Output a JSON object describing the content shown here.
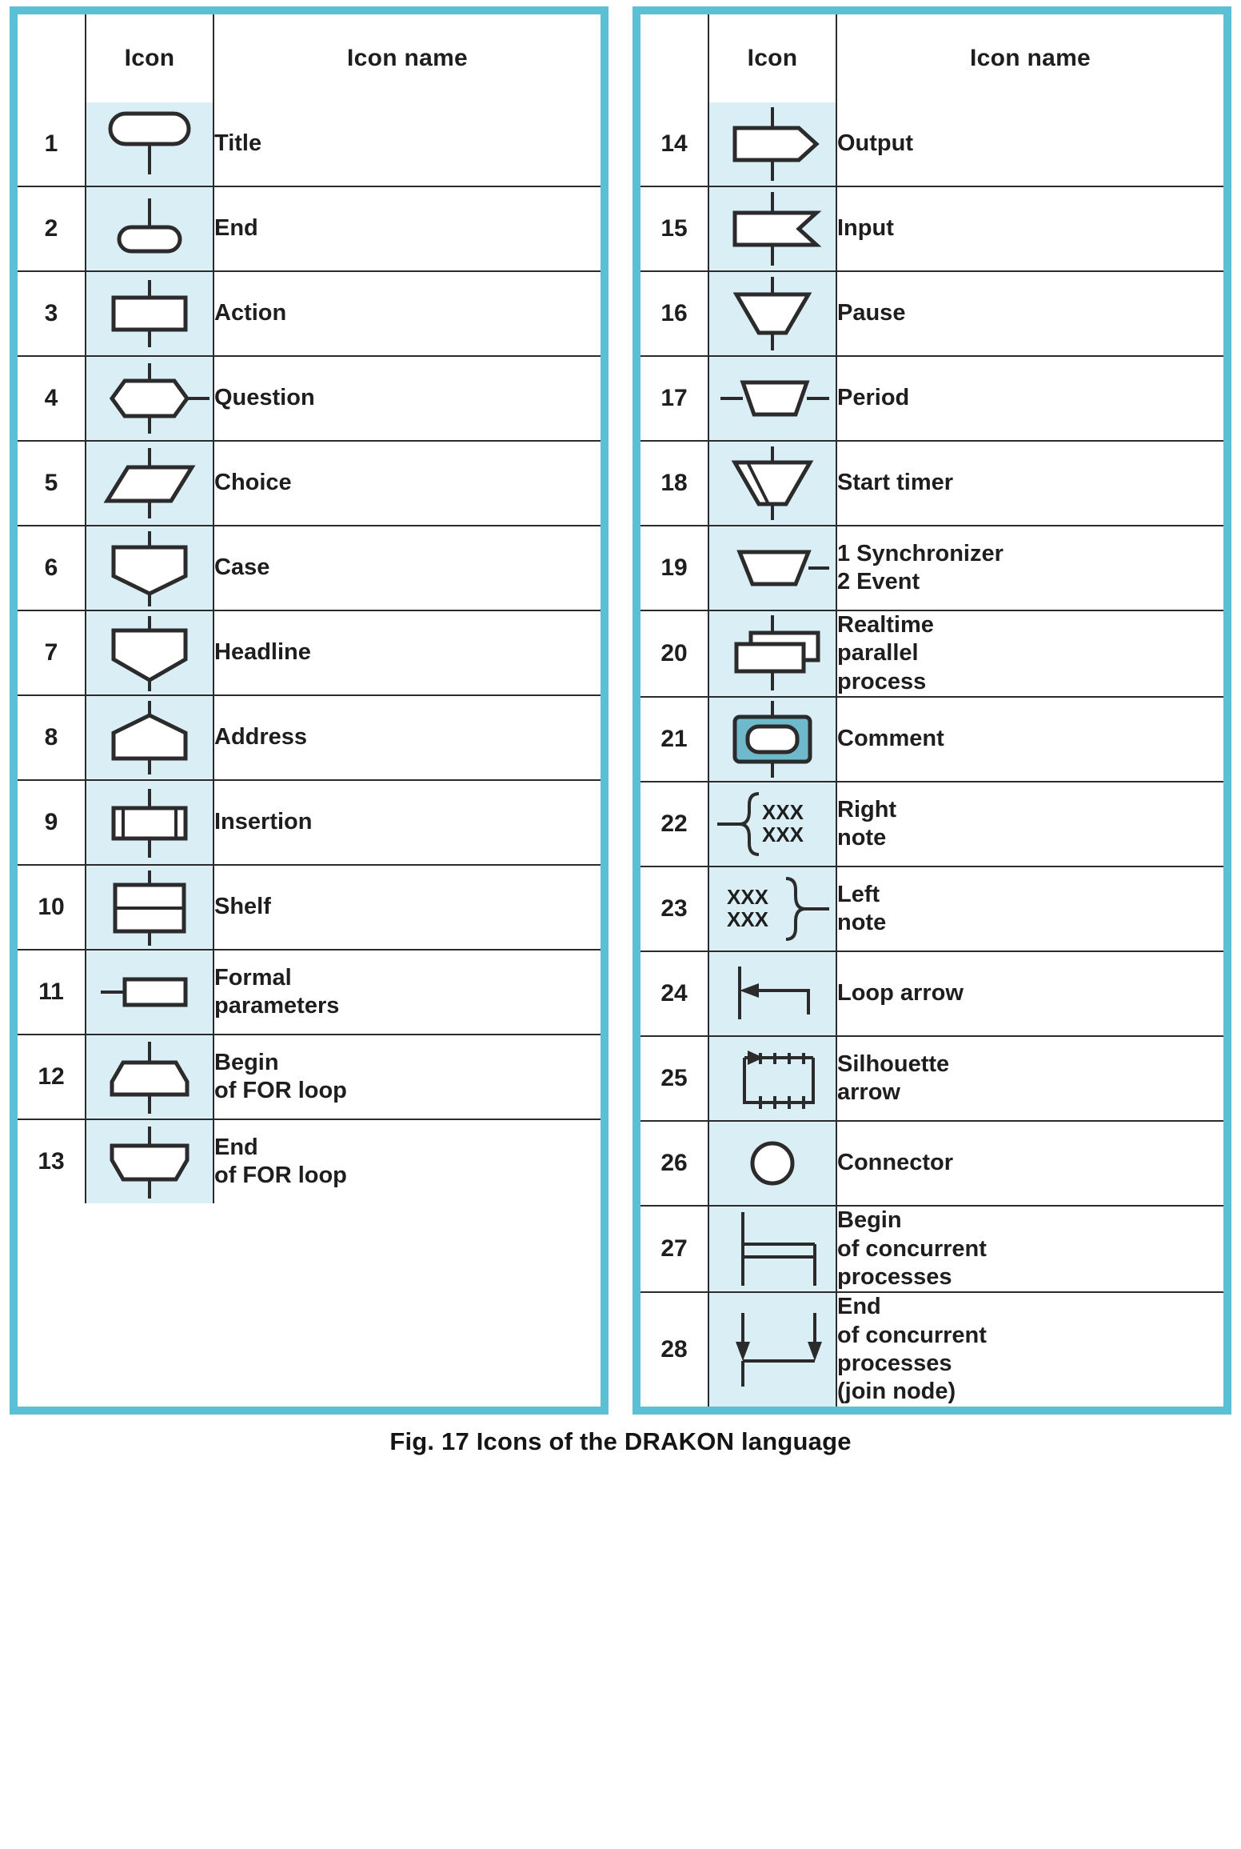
{
  "caption": "Fig. 17  Icons of the DRAKON language",
  "theme": {
    "frame_color": "#5bc0d4",
    "icon_cell_bg": "#d9eef5",
    "line_color": "#2b2b2b",
    "text_color": "#1e1e1e"
  },
  "left_table": {
    "headers": {
      "number": "",
      "icon": "Icon",
      "name": "Icon name"
    },
    "rows": [
      {
        "num": "1",
        "icon": "title-icon",
        "name_lines": [
          "Title"
        ]
      },
      {
        "num": "2",
        "icon": "end-icon",
        "name_lines": [
          "End"
        ]
      },
      {
        "num": "3",
        "icon": "action-icon",
        "name_lines": [
          "Action"
        ]
      },
      {
        "num": "4",
        "icon": "question-icon",
        "name_lines": [
          "Question"
        ]
      },
      {
        "num": "5",
        "icon": "choice-icon",
        "name_lines": [
          "Choice"
        ]
      },
      {
        "num": "6",
        "icon": "case-icon",
        "name_lines": [
          "Case"
        ]
      },
      {
        "num": "7",
        "icon": "headline-icon",
        "name_lines": [
          "Headline"
        ]
      },
      {
        "num": "8",
        "icon": "address-icon",
        "name_lines": [
          "Address"
        ]
      },
      {
        "num": "9",
        "icon": "insertion-icon",
        "name_lines": [
          "Insertion"
        ]
      },
      {
        "num": "10",
        "icon": "shelf-icon",
        "name_lines": [
          "Shelf"
        ]
      },
      {
        "num": "11",
        "icon": "formal-parameters-icon",
        "name_lines": [
          "Formal",
          "parameters"
        ]
      },
      {
        "num": "12",
        "icon": "begin-for-loop-icon",
        "name_lines": [
          "Begin",
          "of FOR loop"
        ]
      },
      {
        "num": "13",
        "icon": "end-for-loop-icon",
        "name_lines": [
          "End",
          "of FOR loop"
        ]
      }
    ]
  },
  "right_table": {
    "headers": {
      "number": "",
      "icon": "Icon",
      "name": "Icon name"
    },
    "rows": [
      {
        "num": "14",
        "icon": "output-icon",
        "name_lines": [
          "Output"
        ]
      },
      {
        "num": "15",
        "icon": "input-icon",
        "name_lines": [
          "Input"
        ]
      },
      {
        "num": "16",
        "icon": "pause-icon",
        "name_lines": [
          "Pause"
        ]
      },
      {
        "num": "17",
        "icon": "period-icon",
        "name_lines": [
          "Period"
        ]
      },
      {
        "num": "18",
        "icon": "start-timer-icon",
        "name_lines": [
          "Start timer"
        ]
      },
      {
        "num": "19",
        "icon": "synchronizer-event-icon",
        "name_lines": [
          "1 Synchronizer",
          "2 Event"
        ]
      },
      {
        "num": "20",
        "icon": "realtime-parallel-icon",
        "name_lines": [
          "Realtime",
          "parallel",
          "process"
        ]
      },
      {
        "num": "21",
        "icon": "comment-icon",
        "name_lines": [
          "Comment"
        ]
      },
      {
        "num": "22",
        "icon": "right-note-icon",
        "name_lines": [
          "Right",
          "note"
        ],
        "glyph_text": [
          "XXX",
          "XXX"
        ]
      },
      {
        "num": "23",
        "icon": "left-note-icon",
        "name_lines": [
          "Left",
          "note"
        ],
        "glyph_text": [
          "XXX",
          "XXX"
        ]
      },
      {
        "num": "24",
        "icon": "loop-arrow-icon",
        "name_lines": [
          "Loop arrow"
        ]
      },
      {
        "num": "25",
        "icon": "silhouette-arrow-icon",
        "name_lines": [
          "Silhouette",
          "arrow"
        ]
      },
      {
        "num": "26",
        "icon": "connector-icon",
        "name_lines": [
          "Connector"
        ]
      },
      {
        "num": "27",
        "icon": "begin-concurrent-icon",
        "name_lines": [
          "Begin",
          "of concurrent",
          "processes"
        ]
      },
      {
        "num": "28",
        "icon": "end-concurrent-icon",
        "name_lines": [
          "End",
          "of concurrent",
          "processes",
          "(join node)"
        ]
      }
    ]
  }
}
